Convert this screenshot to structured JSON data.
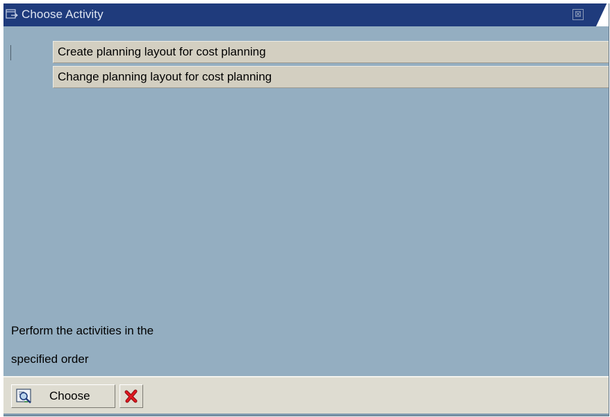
{
  "window": {
    "title": "Choose Activity",
    "close_glyph": "⊠"
  },
  "activities": [
    {
      "label": "Create planning layout for cost planning"
    },
    {
      "label": "Change planning layout for cost planning"
    }
  ],
  "hint": {
    "line1": "Perform the activities in the",
    "line2": "specified order"
  },
  "toolbar": {
    "choose_label": "Choose",
    "choose_icon": "choose-magnifier-icon",
    "cancel_icon": "red-x-cancel-icon"
  },
  "colors": {
    "titlebar": "#1f3b7c",
    "body": "#94aec1",
    "item_bg": "#d3cfc1",
    "toolbar_bg": "#dedcd1",
    "cancel_red": "#d8161c"
  }
}
